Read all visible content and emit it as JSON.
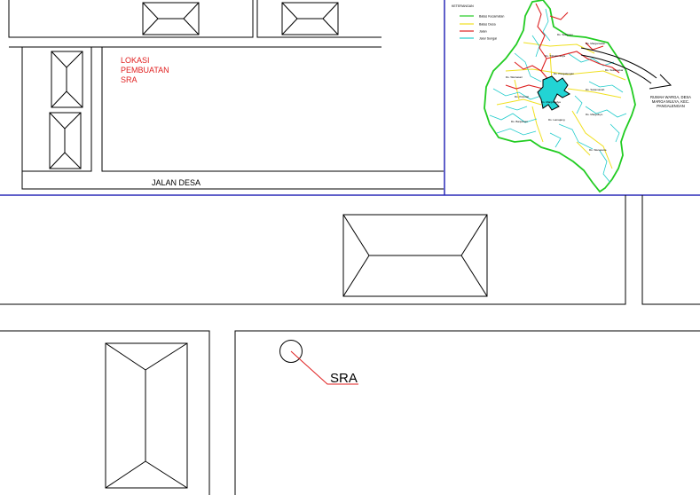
{
  "plan": {
    "site_label_lines": [
      "LOKASI",
      "PEMBUATAN",
      "SRA"
    ],
    "road_label": "JALAN DESA",
    "sra_label": "SRA"
  },
  "inset_map": {
    "legend_title": "KETERANGAN",
    "legend_items": [
      {
        "label": "Batas Kecamatan",
        "color": "#22cc22"
      },
      {
        "label": "Batas Desa",
        "color": "#f0e020"
      },
      {
        "label": "Jalan",
        "color": "#dd2222"
      },
      {
        "label": "Jalur Sungai",
        "color": "#22cccc"
      }
    ],
    "callout_lines": [
      "RUMAH WARGA, DESA",
      "MARGA MULYA, KEC.",
      "PANGALENGAN"
    ],
    "village_labels": [
      "Ds. Margamekar",
      "Ds. Pangalengan",
      "Ds. Margamulya",
      "Ds. Sukamanah",
      "Ds. Warnasari",
      "Ds. Pulosari",
      "Ds. Banjarsari",
      "Ds. Lamajang",
      "Ds. Tribaktimulya",
      "Ds. Sukaluyu",
      "Ds. Margaluyu",
      "Ds. Wanasuka",
      "Ds. Sukamekar"
    ]
  },
  "colors": {
    "line": "#000000",
    "border": "#2a2ab8",
    "label_red": "#e02020",
    "lake": "#22d4d4"
  }
}
